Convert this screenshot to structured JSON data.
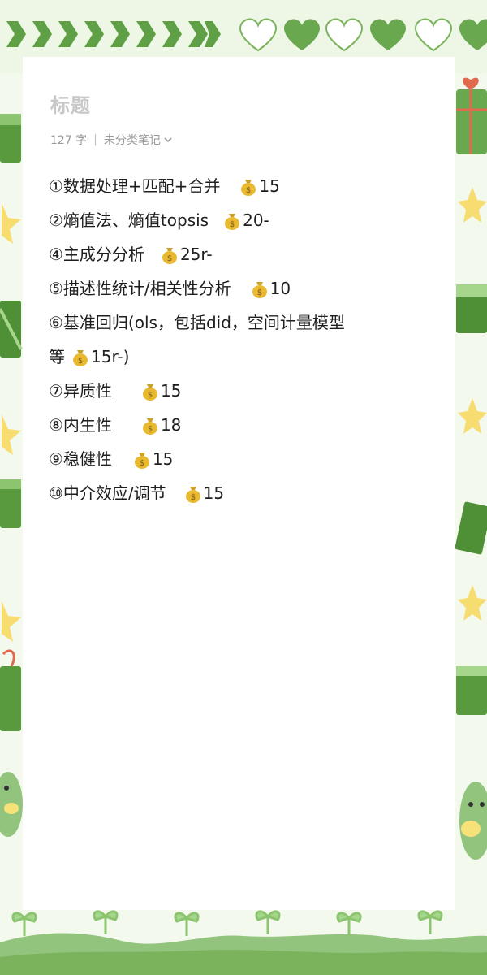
{
  "note": {
    "title": "标题",
    "word_count": "127 字",
    "category": "未分类笔记"
  },
  "items": [
    {
      "label": "①数据处理+匹配+合并",
      "price": "15"
    },
    {
      "label": "②熵值法、熵值topsis",
      "price": "20-"
    },
    {
      "label": "④主成分分析",
      "price": "25r-"
    },
    {
      "label": "⑤描述性统计/相关性分析",
      "price": "10"
    },
    {
      "label": "⑥基准回归(ols，包括did，空间计量模型",
      "label_cont": "等",
      "price": "15r-)"
    },
    {
      "label": "⑦异质性",
      "price": "15"
    },
    {
      "label": "⑧内生性",
      "price": "18"
    },
    {
      "label": "⑨稳健性",
      "price": "15"
    },
    {
      "label": "⑩中介效应/调节",
      "price": "15"
    }
  ],
  "decor": {
    "accent_green": "#6aa84f",
    "light_green": "#a5cf8a",
    "star_yellow": "#f7dc6f"
  }
}
